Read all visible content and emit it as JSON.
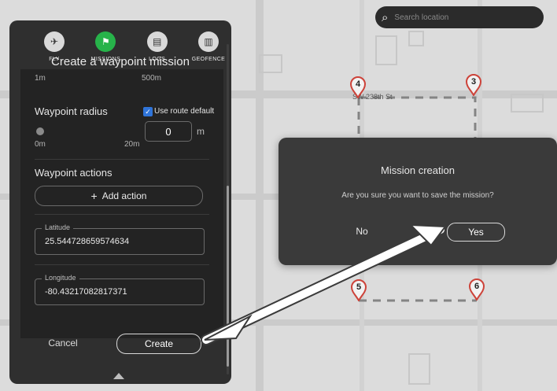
{
  "search": {
    "placeholder": "Search location",
    "icon": "search-icon"
  },
  "nav": {
    "items": [
      {
        "label": "FLY",
        "icon": "plane-icon",
        "active": false
      },
      {
        "label": "MISSIONS",
        "icon": "flag-icon",
        "active": true
      },
      {
        "label": "LOGS",
        "icon": "document-icon",
        "active": false
      },
      {
        "label": "GEOFENCE",
        "icon": "geofence-icon",
        "active": false
      }
    ]
  },
  "panel": {
    "title": "Create a waypoint mission",
    "scale": {
      "min": "1m",
      "max": "500m"
    },
    "waypoint_radius": {
      "label": "Waypoint radius",
      "use_route_default_label": "Use route default",
      "use_route_default_checked": true,
      "min": "0m",
      "max": "20m",
      "value": "0",
      "unit": "m"
    },
    "waypoint_actions": {
      "label": "Waypoint actions",
      "add_action_label": "Add action"
    },
    "latitude": {
      "label": "Latitude",
      "value": "25.544728659574634"
    },
    "longitude": {
      "label": "Longitude",
      "value": "-80.43217082817371"
    },
    "cancel_label": "Cancel",
    "create_label": "Create"
  },
  "map": {
    "street_label": "SW 238th St",
    "waypoints": [
      "4",
      "3",
      "5",
      "6"
    ],
    "accent": "#d8453b"
  },
  "dialog": {
    "title": "Mission creation",
    "message": "Are you sure you want to save the mission?",
    "no_label": "No",
    "yes_label": "Yes"
  },
  "colors": {
    "panel_bg": "#2f2f2f",
    "panel_inner_bg": "#232323",
    "dialog_bg": "#3a3a3a",
    "active_nav": "#27b34a",
    "checkbox": "#2f74d9"
  }
}
